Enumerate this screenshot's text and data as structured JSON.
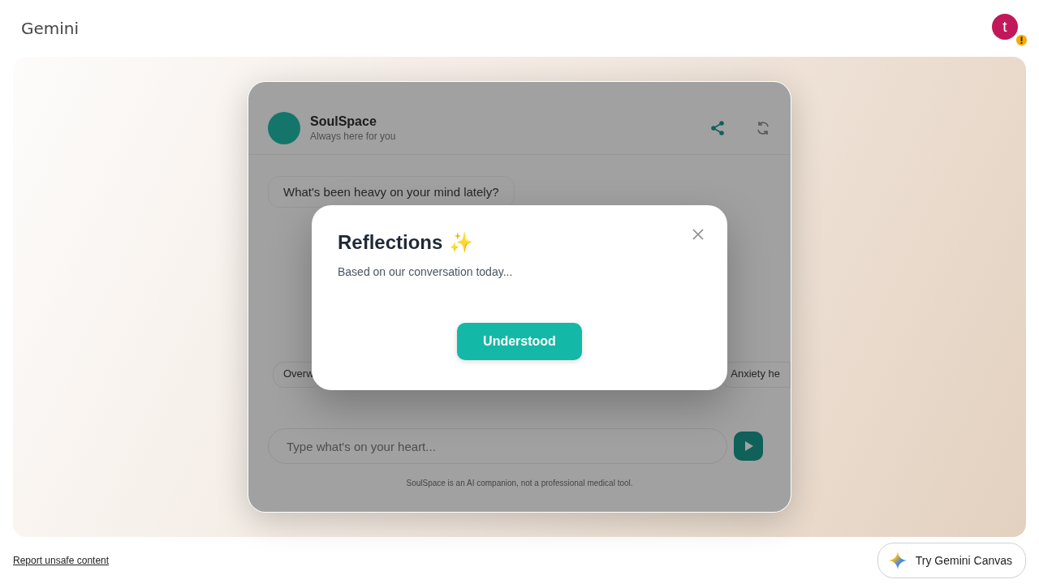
{
  "header": {
    "title": "Gemini",
    "avatar": {
      "letter": "t",
      "warning": true
    }
  },
  "app": {
    "name": "SoulSpace",
    "tagline": "Always here for you",
    "message": "What's been heavy on your mind lately?",
    "chips": [
      "Overw",
      "Anxiety he"
    ],
    "input": {
      "placeholder": "Type what's on your heart..."
    },
    "disclaimer": "SoulSpace is an AI companion, not a professional medical tool."
  },
  "dialog": {
    "title": "Reflections",
    "emoji": "✨",
    "text": "Based on our conversation today...",
    "button": "Understood"
  },
  "footer": {
    "report_link": "Report unsafe content",
    "canvas_button": "Try Gemini Canvas"
  }
}
